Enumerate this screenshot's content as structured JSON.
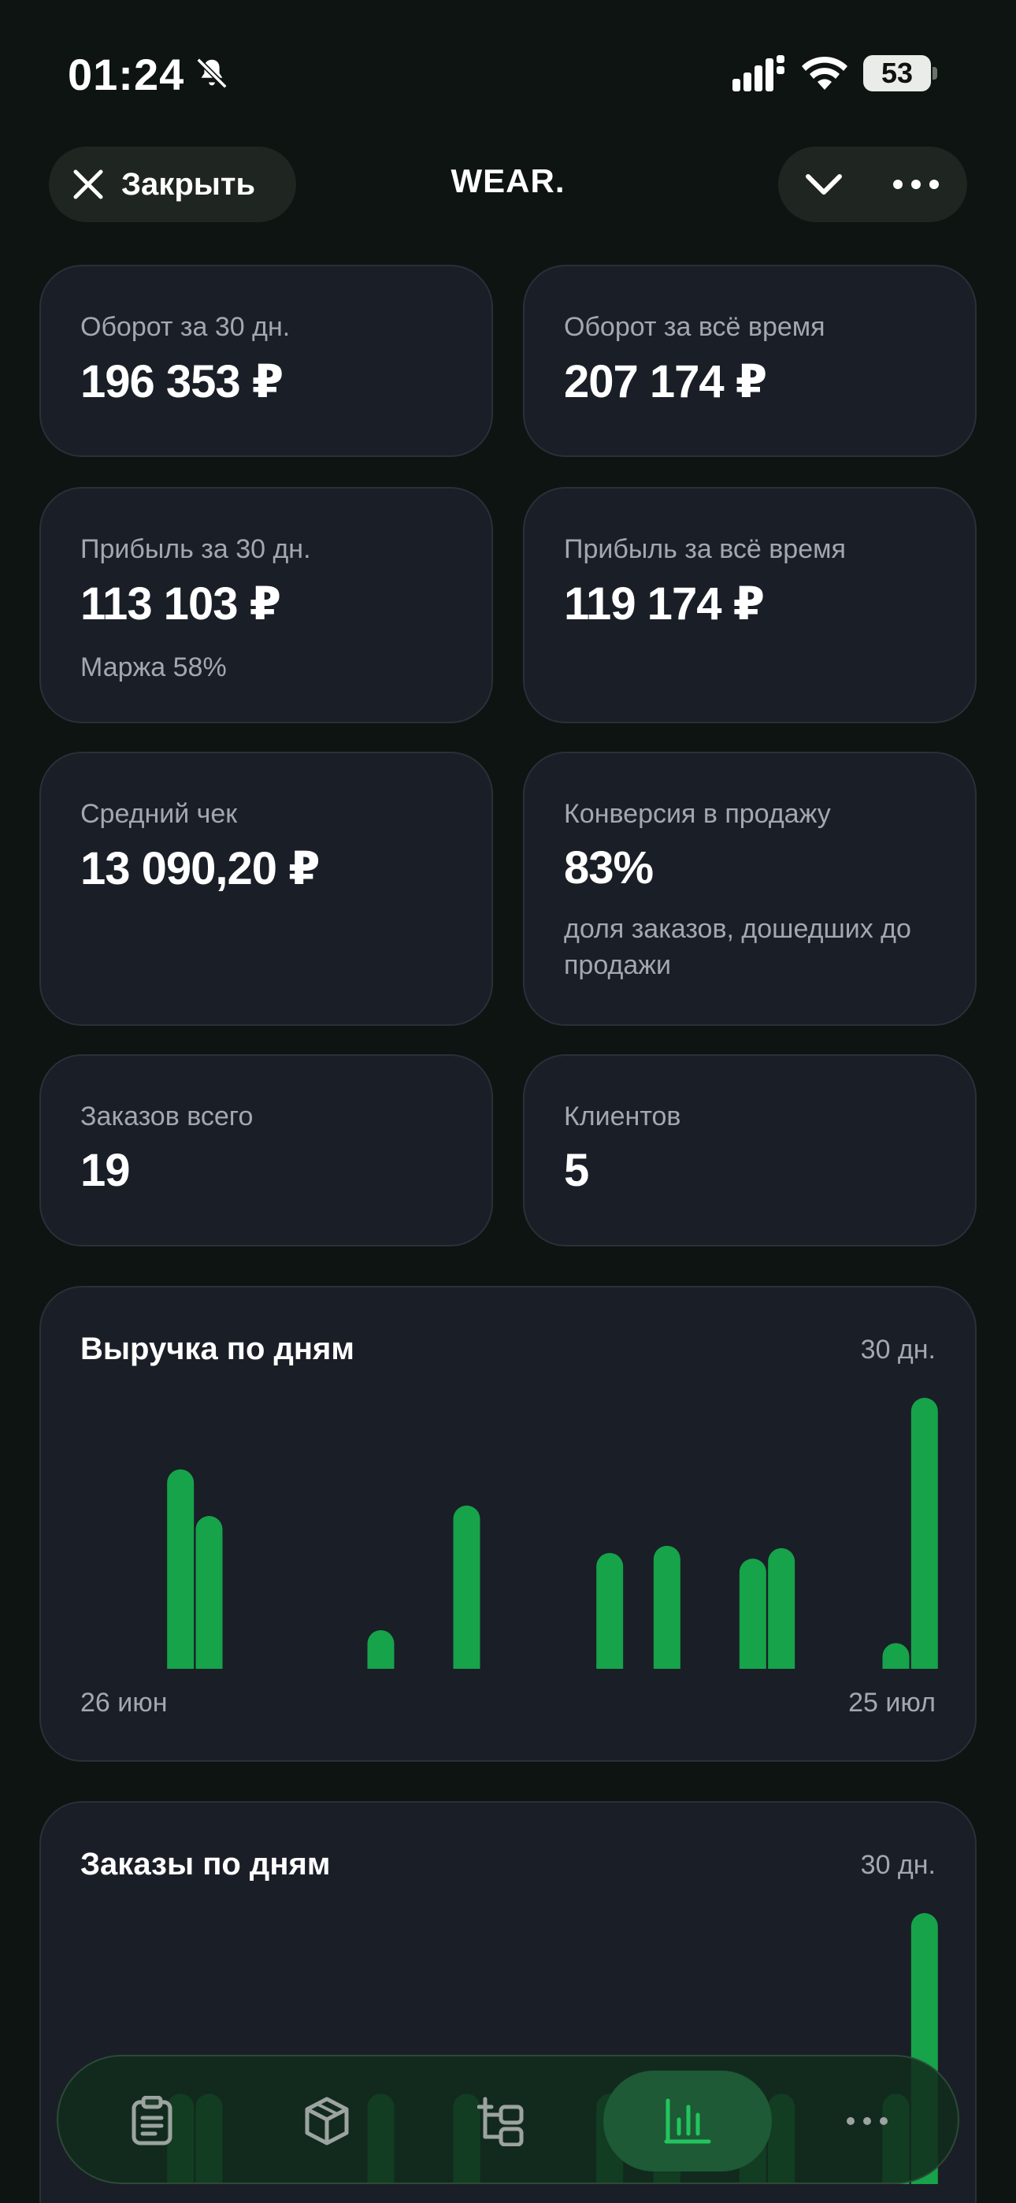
{
  "status_bar": {
    "time": "01:24",
    "battery": "53"
  },
  "header": {
    "close_label": "Закрыть",
    "title": "WEAR."
  },
  "stats": [
    {
      "label": "Оборот за 30 дн.",
      "value": "196 353 ₽",
      "sub": ""
    },
    {
      "label": "Оборот за всё время",
      "value": "207 174 ₽",
      "sub": ""
    },
    {
      "label": "Прибыль за 30 дн.",
      "value": "113 103 ₽",
      "sub": "Маржа 58%"
    },
    {
      "label": "Прибыль за всё время",
      "value": "119 174 ₽",
      "sub": ""
    },
    {
      "label": "Средний чек",
      "value": "13 090,20 ₽",
      "sub": ""
    },
    {
      "label": "Конверсия в продажу",
      "value": "83%",
      "sub": "доля заказов, дошедших до продажи"
    },
    {
      "label": "Заказов всего",
      "value": "19",
      "sub": ""
    },
    {
      "label": "Клиентов",
      "value": "5",
      "sub": ""
    }
  ],
  "revenue_chart": {
    "title": "Выручка по дням",
    "period": "30 дн.",
    "x_start": "26 июн",
    "x_end": "25 июл"
  },
  "orders_chart": {
    "title": "Заказы по дням",
    "period": "30 дн."
  },
  "chart_data": [
    {
      "type": "bar",
      "title": "Выручка по дням",
      "x_range": [
        "26 июн",
        "25 июл"
      ],
      "days": 30,
      "values": [
        0,
        0,
        0,
        24800,
        19000,
        0,
        0,
        0,
        0,
        0,
        4800,
        0,
        0,
        20300,
        0,
        0,
        0,
        0,
        14400,
        0,
        15300,
        0,
        0,
        13700,
        15000,
        0,
        0,
        0,
        3200,
        33700
      ],
      "color": "#16a34a"
    },
    {
      "type": "bar",
      "title": "Заказы по дням",
      "days": 30,
      "values": [
        0,
        0,
        0,
        1,
        1,
        0,
        0,
        0,
        0,
        0,
        1,
        0,
        0,
        1,
        0,
        0,
        0,
        0,
        1,
        0,
        1,
        0,
        0,
        1,
        1,
        0,
        0,
        0,
        1,
        3
      ],
      "color": "#16a34a"
    }
  ],
  "bottom_nav": {
    "items": [
      "clipboard-icon",
      "box-icon",
      "tree-icon",
      "chart-icon",
      "more-icon"
    ],
    "active_index": 3,
    "accent": "#22c55e"
  }
}
